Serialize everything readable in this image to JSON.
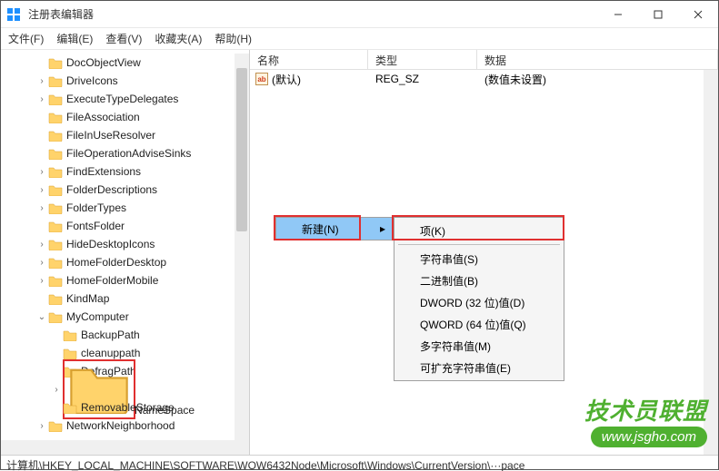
{
  "window": {
    "title": "注册表编辑器"
  },
  "menu": {
    "file": "文件(F)",
    "edit": "编辑(E)",
    "view": "查看(V)",
    "favorites": "收藏夹(A)",
    "help": "帮助(H)"
  },
  "tree": {
    "items": [
      {
        "label": "DocObjectView",
        "depth": 2,
        "exp": ""
      },
      {
        "label": "DriveIcons",
        "depth": 2,
        "exp": "›"
      },
      {
        "label": "ExecuteTypeDelegates",
        "depth": 2,
        "exp": "›"
      },
      {
        "label": "FileAssociation",
        "depth": 2,
        "exp": ""
      },
      {
        "label": "FileInUseResolver",
        "depth": 2,
        "exp": ""
      },
      {
        "label": "FileOperationAdviseSinks",
        "depth": 2,
        "exp": ""
      },
      {
        "label": "FindExtensions",
        "depth": 2,
        "exp": "›"
      },
      {
        "label": "FolderDescriptions",
        "depth": 2,
        "exp": "›"
      },
      {
        "label": "FolderTypes",
        "depth": 2,
        "exp": "›"
      },
      {
        "label": "FontsFolder",
        "depth": 2,
        "exp": ""
      },
      {
        "label": "HideDesktopIcons",
        "depth": 2,
        "exp": "›"
      },
      {
        "label": "HomeFolderDesktop",
        "depth": 2,
        "exp": "›"
      },
      {
        "label": "HomeFolderMobile",
        "depth": 2,
        "exp": "›"
      },
      {
        "label": "KindMap",
        "depth": 2,
        "exp": ""
      },
      {
        "label": "MyComputer",
        "depth": 2,
        "exp": "⌄"
      },
      {
        "label": "BackupPath",
        "depth": 3,
        "exp": ""
      },
      {
        "label": "cleanuppath",
        "depth": 3,
        "exp": ""
      },
      {
        "label": "DefragPath",
        "depth": 3,
        "exp": ""
      },
      {
        "label": "NameSpace",
        "depth": 3,
        "exp": "›",
        "selected": true
      },
      {
        "label": "RemovableStorage",
        "depth": 3,
        "exp": ""
      },
      {
        "label": "NetworkNeighborhood",
        "depth": 2,
        "exp": "›"
      }
    ]
  },
  "list": {
    "headers": {
      "name": "名称",
      "type": "类型",
      "data": "数据"
    },
    "rows": [
      {
        "name": "(默认)",
        "type": "REG_SZ",
        "data": "(数值未设置)"
      }
    ]
  },
  "context_menu": {
    "new": "新建(N)",
    "submenu": {
      "key": "项(K)",
      "string": "字符串值(S)",
      "binary": "二进制值(B)",
      "dword": "DWORD (32 位)值(D)",
      "qword": "QWORD (64 位)值(Q)",
      "multi": "多字符串值(M)",
      "expand": "可扩充字符串值(E)"
    }
  },
  "statusbar": "计算机\\HKEY_LOCAL_MACHINE\\SOFTWARE\\WOW6432Node\\Microsoft\\Windows\\CurrentVersion\\···pace",
  "watermark": {
    "text": "技术员联盟",
    "url": "www.jsgho.com"
  }
}
